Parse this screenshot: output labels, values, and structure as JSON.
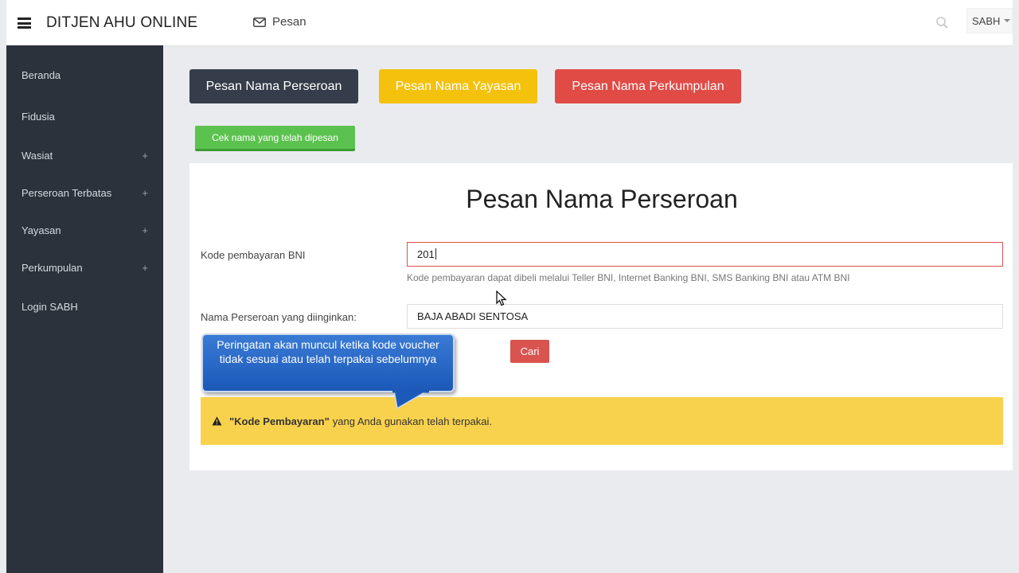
{
  "header": {
    "brand": "DITJEN AHU ONLINE",
    "message_link": "Pesan",
    "user": "SABH"
  },
  "sidebar": {
    "items": [
      {
        "label": "Beranda",
        "expandable": false
      },
      {
        "label": "Fidusia",
        "expandable": false
      },
      {
        "label": "Wasiat",
        "expandable": true
      },
      {
        "label": "Perseroan Terbatas",
        "expandable": true
      },
      {
        "label": "Yayasan",
        "expandable": true
      },
      {
        "label": "Perkumpulan",
        "expandable": true
      },
      {
        "label": "Login SABH",
        "expandable": false
      }
    ],
    "expand_symbol": "+"
  },
  "actions": {
    "perseroan": "Pesan Nama Perseroan",
    "yayasan": "Pesan Nama Yayasan",
    "perkumpulan": "Pesan Nama Perkumpulan",
    "check_reserved": "Cek nama yang telah dipesan"
  },
  "form": {
    "title": "Pesan Nama Perseroan",
    "bni_label": "Kode pembayaran BNI",
    "bni_value": "201",
    "bni_help": "Kode pembayaran dapat dibeli melalui Teller BNI, Internet Banking BNI, SMS Banking BNI atau ATM BNI",
    "name_label": "Nama Perseroan yang diinginkan:",
    "name_value": "BAJA ABADI SENTOSA",
    "search_button": "Cari"
  },
  "alert": {
    "bold": "\"Kode Pembayaran\"",
    "message": "yang Anda gunakan telah terpakai."
  },
  "callout": {
    "text": "Peringatan akan muncul ketika kode voucher tidak sesuai atau telah terpakai sebelumnya"
  },
  "colors": {
    "sidebar_bg": "#2c323c",
    "perseroan_btn": "#363d4a",
    "yayasan_btn": "#f4c10d",
    "perkumpulan_btn": "#e04b46",
    "check_btn": "#5cc24f",
    "alert_bg": "#f9d24d",
    "callout_bg": "#2a69c9"
  },
  "icons": {
    "menu": "hamburger-icon",
    "message": "envelope-icon",
    "search": "search-icon",
    "warning": "warning-triangle-icon"
  }
}
